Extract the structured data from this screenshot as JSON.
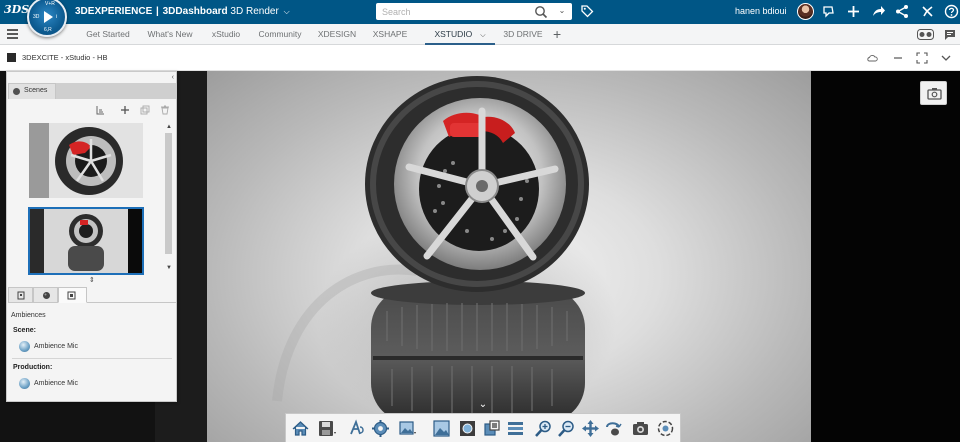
{
  "header": {
    "logo": "3DS",
    "compass": {
      "top": "V+R",
      "left": "3D",
      "right": "i",
      "bottom": "6,R"
    },
    "brand_bold": "3DEXPERIENCE",
    "brand_sep": "|",
    "brand_dashboard": "3DDashboard",
    "brand_app": "3D Render",
    "search_placeholder": "Search",
    "username": "hanen bdioui",
    "brand_color": "#005686"
  },
  "tabs": {
    "items": [
      {
        "label": "Get Started"
      },
      {
        "label": "What's New"
      },
      {
        "label": "xStudio"
      },
      {
        "label": "Community"
      },
      {
        "label": "XDESIGN"
      },
      {
        "label": "XSHAPE"
      },
      {
        "label": "XSTUDIO"
      },
      {
        "label": "3D DRIVE"
      }
    ],
    "active": "XSTUDIO"
  },
  "app": {
    "title": "3DEXCITE - xStudio - HB"
  },
  "panel": {
    "scenes_tab": "Scenes",
    "section_title": "Ambiences",
    "scene_label": "Scene:",
    "scene_item": "Ambience Mic",
    "production_label": "Production:",
    "production_item": "Ambience Mic"
  },
  "toolbar": {
    "icons": [
      "home-icon",
      "save-icon",
      "render-style-icon",
      "settings-icon",
      "scene-image-icon",
      "image-icon",
      "environment-icon",
      "capture-icon",
      "layers-icon",
      "zoom-in-icon",
      "zoom-out-icon",
      "pan-icon",
      "rotate-icon",
      "camera-icon",
      "reframe-icon"
    ]
  }
}
